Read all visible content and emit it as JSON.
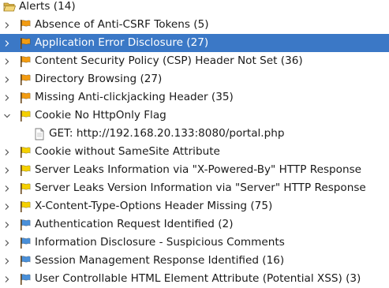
{
  "root": {
    "label": "Alerts (14)",
    "icon": "folder-open-icon"
  },
  "alerts": [
    {
      "label": "Absence of Anti-CSRF Tokens (5)",
      "risk": "medium",
      "flag_color": "#f39c12",
      "expanded": false,
      "selected": false
    },
    {
      "label": "Application Error Disclosure (27)",
      "risk": "medium",
      "flag_color": "#f39c12",
      "expanded": false,
      "selected": true
    },
    {
      "label": "Content Security Policy (CSP) Header Not Set (36)",
      "risk": "medium",
      "flag_color": "#f39c12",
      "expanded": false,
      "selected": false
    },
    {
      "label": "Directory Browsing (27)",
      "risk": "medium",
      "flag_color": "#f39c12",
      "expanded": false,
      "selected": false
    },
    {
      "label": "Missing Anti-clickjacking Header (35)",
      "risk": "medium",
      "flag_color": "#f39c12",
      "expanded": false,
      "selected": false
    },
    {
      "label": "Cookie No HttpOnly Flag",
      "risk": "low",
      "flag_color": "#f5d000",
      "expanded": true,
      "selected": false,
      "children": [
        {
          "label": "GET: http://192.168.20.133:8080/portal.php",
          "icon": "document-icon"
        }
      ]
    },
    {
      "label": "Cookie without SameSite Attribute",
      "risk": "low",
      "flag_color": "#f5d000",
      "expanded": false,
      "selected": false
    },
    {
      "label": "Server Leaks Information via \"X-Powered-By\" HTTP Response",
      "risk": "low",
      "flag_color": "#f5d000",
      "expanded": false,
      "selected": false
    },
    {
      "label": "Server Leaks Version Information via \"Server\" HTTP Response",
      "risk": "low",
      "flag_color": "#f5d000",
      "expanded": false,
      "selected": false
    },
    {
      "label": "X-Content-Type-Options Header Missing (75)",
      "risk": "low",
      "flag_color": "#f5d000",
      "expanded": false,
      "selected": false
    },
    {
      "label": "Authentication Request Identified (2)",
      "risk": "informational",
      "flag_color": "#4a90d9",
      "expanded": false,
      "selected": false
    },
    {
      "label": "Information Disclosure - Suspicious Comments",
      "risk": "informational",
      "flag_color": "#4a90d9",
      "expanded": false,
      "selected": false
    },
    {
      "label": "Session Management Response Identified (16)",
      "risk": "informational",
      "flag_color": "#4a90d9",
      "expanded": false,
      "selected": false
    },
    {
      "label": "User Controllable HTML Element Attribute (Potential XSS) (3)",
      "risk": "informational",
      "flag_color": "#4a90d9",
      "expanded": false,
      "selected": false
    }
  ]
}
